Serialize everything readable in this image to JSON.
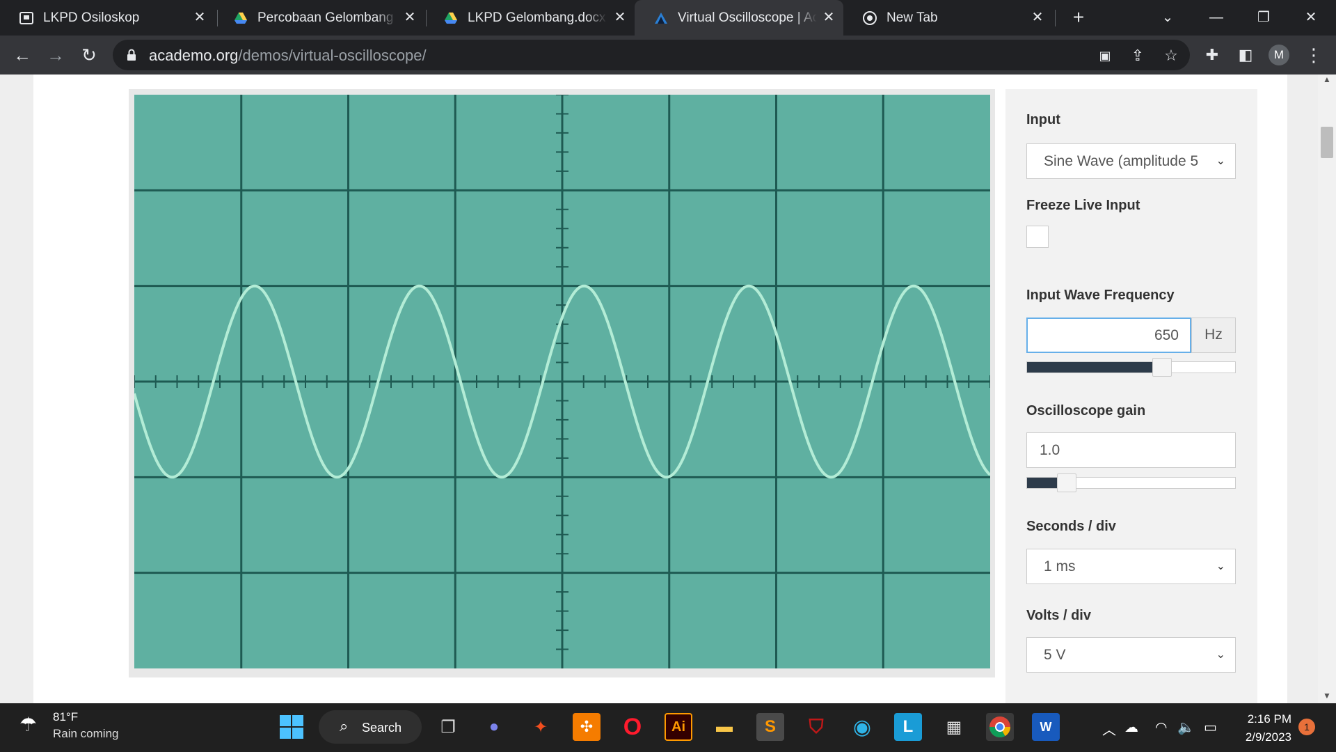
{
  "browser": {
    "tabs": [
      {
        "title": "LKPD Osiloskop",
        "icon": "document-icon"
      },
      {
        "title": "Percobaan Gelombang .pdf",
        "icon": "google-drive-icon"
      },
      {
        "title": "LKPD Gelombang.docx - Google",
        "icon": "google-drive-icon"
      },
      {
        "title": "Virtual Oscilloscope | Academo",
        "icon": "academo-icon",
        "active": true
      },
      {
        "title": "New Tab",
        "icon": "chrome-icon"
      }
    ],
    "url_domain": "academo.org",
    "url_path": "/demos/virtual-oscilloscope/",
    "profile_initial": "M"
  },
  "oscilloscope": {
    "grid_cols": 8,
    "grid_rows": 6,
    "trace_color": "#b3ecd6",
    "screen_color": "#5fb0a1",
    "grid_color": "#1e5a52"
  },
  "panel": {
    "input_label": "Input",
    "input_value": "Sine Wave (amplitude 5",
    "freeze_label": "Freeze Live Input",
    "freq_label": "Input Wave Frequency",
    "freq_value": "650",
    "freq_unit": "Hz",
    "freq_slider_fraction": 0.65,
    "gain_label": "Oscilloscope gain",
    "gain_value": "1.0",
    "gain_slider_fraction": 0.19,
    "seconds_label": "Seconds / div",
    "seconds_value": "1 ms",
    "volts_label": "Volts / div",
    "volts_value": "5 V"
  },
  "taskbar": {
    "weather_temp": "81°F",
    "weather_desc": "Rain coming",
    "search_label": "Search",
    "time": "2:16 PM",
    "date": "2/9/2023",
    "notification_count": "1"
  }
}
